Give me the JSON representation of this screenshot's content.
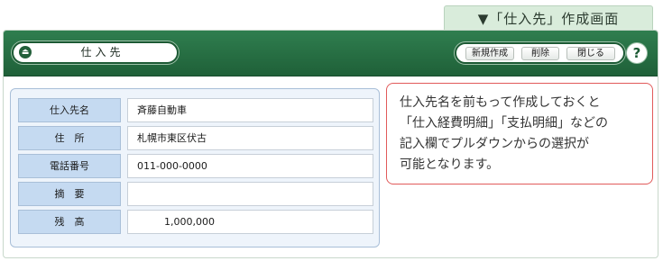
{
  "section_tab": "▼「仕入先」作成画面",
  "title_bar": {
    "icon_glyph": "⏏",
    "title": "仕入先",
    "buttons": [
      "新規作成",
      "削除",
      "閉じる"
    ],
    "help": "?"
  },
  "form": {
    "rows": [
      {
        "label": "仕入先名",
        "value": "斉藤自動車"
      },
      {
        "label": "住　所",
        "value": "札幌市東区伏古"
      },
      {
        "label": "電話番号",
        "value": "011-000-0000"
      },
      {
        "label": "摘　要",
        "value": ""
      },
      {
        "label": "残　高",
        "value": "1,000,000"
      }
    ]
  },
  "note": {
    "lines": [
      "仕入先名を前もって作成しておくと",
      "「仕入経費明細」「支払明細」などの",
      "記入欄でプルダウンからの選択が",
      "可能となります。"
    ]
  },
  "colors": {
    "title_bar": "#2a7447",
    "label_cell": "#c5daf1",
    "panel": "#eef4fb",
    "note_border": "#e15a5a",
    "tab": "#d9ecdb"
  }
}
